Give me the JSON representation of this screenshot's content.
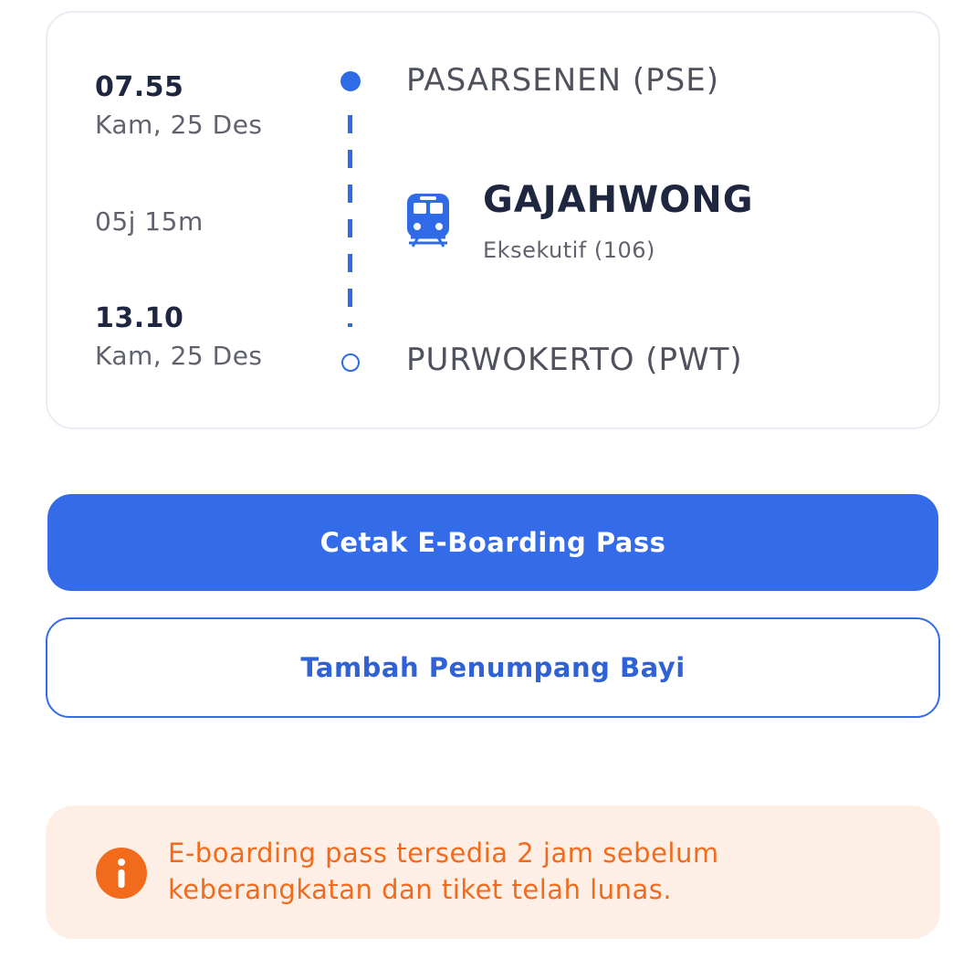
{
  "trip": {
    "departure_time": "07.55",
    "departure_date": "Kam, 25 Des",
    "duration": "05j 15m",
    "arrival_time": "13.10",
    "arrival_date": "Kam, 25 Des",
    "origin_station": "PASARSENEN (PSE)",
    "destination_station": "PURWOKERTO (PWT)",
    "train_name": "GAJAHWONG",
    "train_class": "Eksekutif (106)",
    "train_icon": "train-icon"
  },
  "actions": {
    "print_boarding_pass": "Cetak E-Boarding Pass",
    "add_infant": "Tambah Penumpang Bayi"
  },
  "notice": {
    "icon": "info-icon",
    "line1": "E-boarding pass tersedia 2 jam sebelum",
    "line2": "keberangkatan dan tiket telah lunas."
  },
  "colors": {
    "primary": "#346be9",
    "warning_text": "#f26b1d",
    "warning_bg": "#fdefe6"
  }
}
